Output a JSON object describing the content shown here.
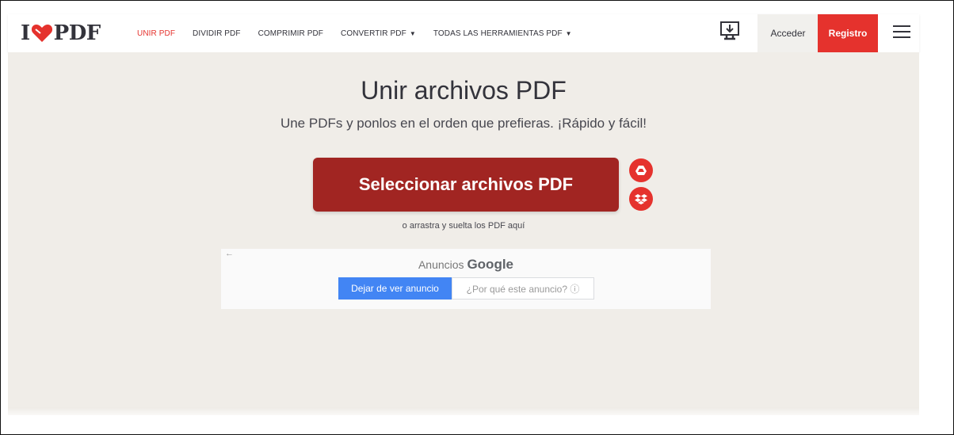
{
  "header": {
    "logo": {
      "left": "I",
      "right": "PDF"
    },
    "nav": [
      {
        "label": "UNIR PDF",
        "active": true,
        "dropdown": false
      },
      {
        "label": "DIVIDIR PDF",
        "active": false,
        "dropdown": false
      },
      {
        "label": "COMPRIMIR PDF",
        "active": false,
        "dropdown": false
      },
      {
        "label": "CONVERTIR PDF",
        "active": false,
        "dropdown": true
      },
      {
        "label": "TODAS LAS HERRAMIENTAS PDF",
        "active": false,
        "dropdown": true
      }
    ],
    "login_label": "Acceder",
    "register_label": "Registro"
  },
  "main": {
    "title": "Unir archivos PDF",
    "subtitle": "Une PDFs y ponlos en el orden que prefieras. ¡Rápido y fácil!",
    "select_button": "Seleccionar archivos PDF",
    "drag_text": "o arrastra y suelta los PDF aquí"
  },
  "ad": {
    "label_prefix": "Anuncios",
    "label_brand": "Google",
    "stop_button": "Dejar de ver anuncio",
    "why_button": "¿Por qué este anuncio? ⓘ"
  },
  "colors": {
    "brand_red": "#e5322d",
    "select_button_bg": "#a12522",
    "main_bg": "#f0ede8",
    "ad_button_blue": "#4285f4"
  },
  "icons": {
    "logo_heart": "heart-icon",
    "desktop": "desktop-download-icon",
    "menu": "hamburger-menu-icon",
    "gdrive": "google-drive-icon",
    "dropbox": "dropbox-icon",
    "ad_back": "back-arrow-icon"
  }
}
